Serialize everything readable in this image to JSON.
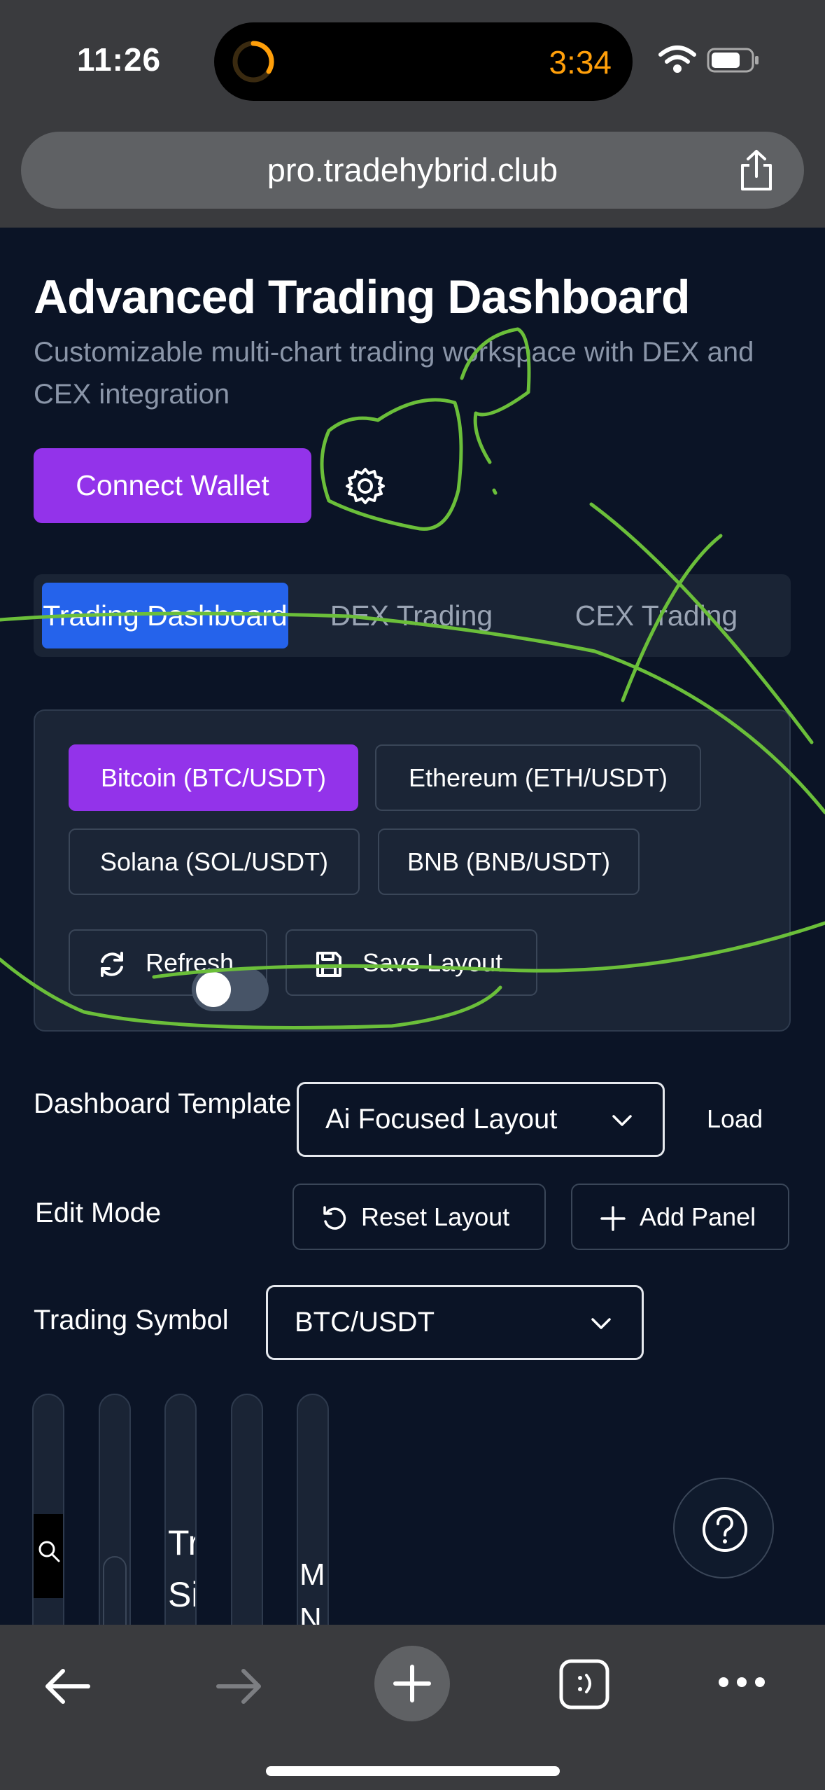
{
  "status_bar": {
    "time": "11:26",
    "timer": "3:34"
  },
  "browser": {
    "url": "pro.tradehybrid.club"
  },
  "header": {
    "title": "Advanced Trading Dashboard",
    "subtitle": "Customizable multi-chart trading workspace with DEX and CEX integration"
  },
  "actions": {
    "connect_wallet": "Connect Wallet"
  },
  "tabs": [
    {
      "label": "Trading Dashboard",
      "active": true
    },
    {
      "label": "DEX Trading",
      "active": false
    },
    {
      "label": "CEX Trading",
      "active": false
    }
  ],
  "pairs": [
    {
      "label": "Bitcoin (BTC/USDT)",
      "active": true
    },
    {
      "label": "Ethereum (ETH/USDT)",
      "active": false
    },
    {
      "label": "Solana (SOL/USDT)",
      "active": false
    },
    {
      "label": "BNB (BNB/USDT)",
      "active": false
    }
  ],
  "panel_actions": {
    "refresh": "Refresh",
    "save_layout": "Save Layout"
  },
  "template": {
    "label": "Dashboard Template",
    "value": "Ai Focused Layout",
    "load": "Load"
  },
  "edit_mode": {
    "label": "Edit Mode",
    "enabled": false,
    "reset": "Reset Layout",
    "add_panel": "Add Panel"
  },
  "symbol": {
    "label": "Trading Symbol",
    "value": "BTC/USDT"
  },
  "mini_panels": {
    "c3_text_1": "Tr",
    "c3_text_2": "Si",
    "c5_text_1": "M",
    "c5_text_2": "N"
  },
  "colors": {
    "accent_purple": "#9333ea",
    "accent_blue": "#2563eb",
    "background": "#0b1426",
    "scribble": "#6bbf3a"
  }
}
